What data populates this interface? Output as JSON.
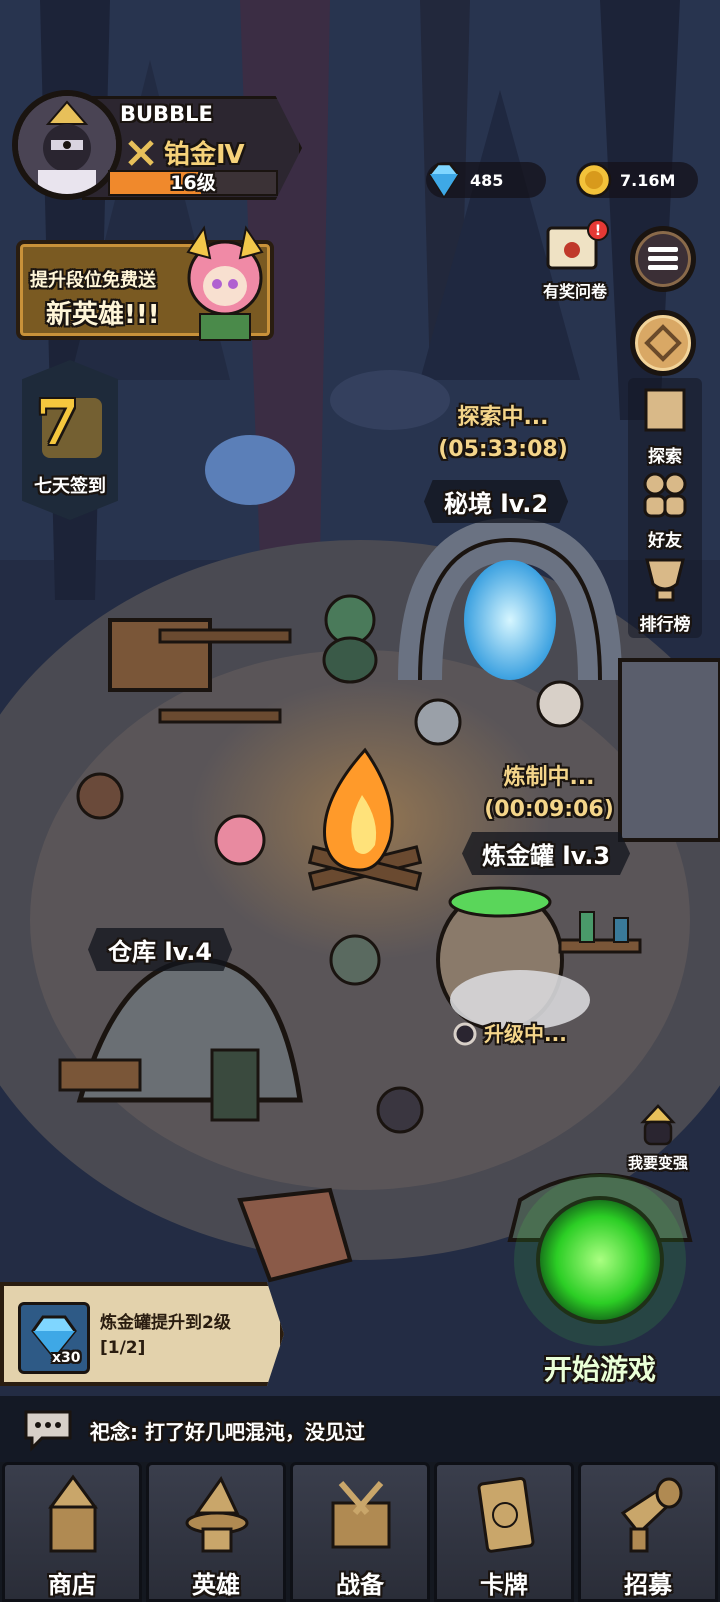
{
  "player": {
    "name": "BUBBLE",
    "rank": "铂金Ⅳ",
    "level": "16级",
    "level_progress": 0.55
  },
  "currencies": {
    "gems": "485",
    "gold": "7.16M"
  },
  "promo": {
    "line1": "提升段位免费送",
    "line2": "新英雄!!!"
  },
  "signin": {
    "day": "7",
    "label": "七天签到"
  },
  "side_menu": {
    "survey": "有奖问卷",
    "explore": "探索",
    "friends": "好友",
    "ranking": "排行榜"
  },
  "buildings": {
    "secret_realm": {
      "status": "探索中...",
      "timer": "(05:33:08)",
      "label": "秘境 lv.2"
    },
    "alchemy": {
      "status": "炼制中...",
      "timer": "(00:09:06)",
      "label": "炼金罐 lv.3",
      "upgrade": "升级中..."
    },
    "warehouse": {
      "label": "仓库 lv.4"
    }
  },
  "quest": {
    "title": "炼金罐提升到2级",
    "progress": "[1/2]",
    "reward_qty": "x30"
  },
  "actions": {
    "get_stronger": "我要变强",
    "start_game": "开始游戏"
  },
  "chat": {
    "message": "祀念: 打了好几吧混沌，没见过"
  },
  "nav": {
    "tabs": [
      {
        "label": "商店",
        "icon": "shop-icon"
      },
      {
        "label": "英雄",
        "icon": "hero-icon"
      },
      {
        "label": "战备",
        "icon": "equipment-icon"
      },
      {
        "label": "卡牌",
        "icon": "card-icon"
      },
      {
        "label": "招募",
        "icon": "recruit-icon"
      }
    ]
  },
  "colors": {
    "gold_text": "#f4d58a",
    "portal_glow": "#6fd3ff",
    "start_glow": "#4dff4a",
    "fire": "#ff9a2a"
  }
}
